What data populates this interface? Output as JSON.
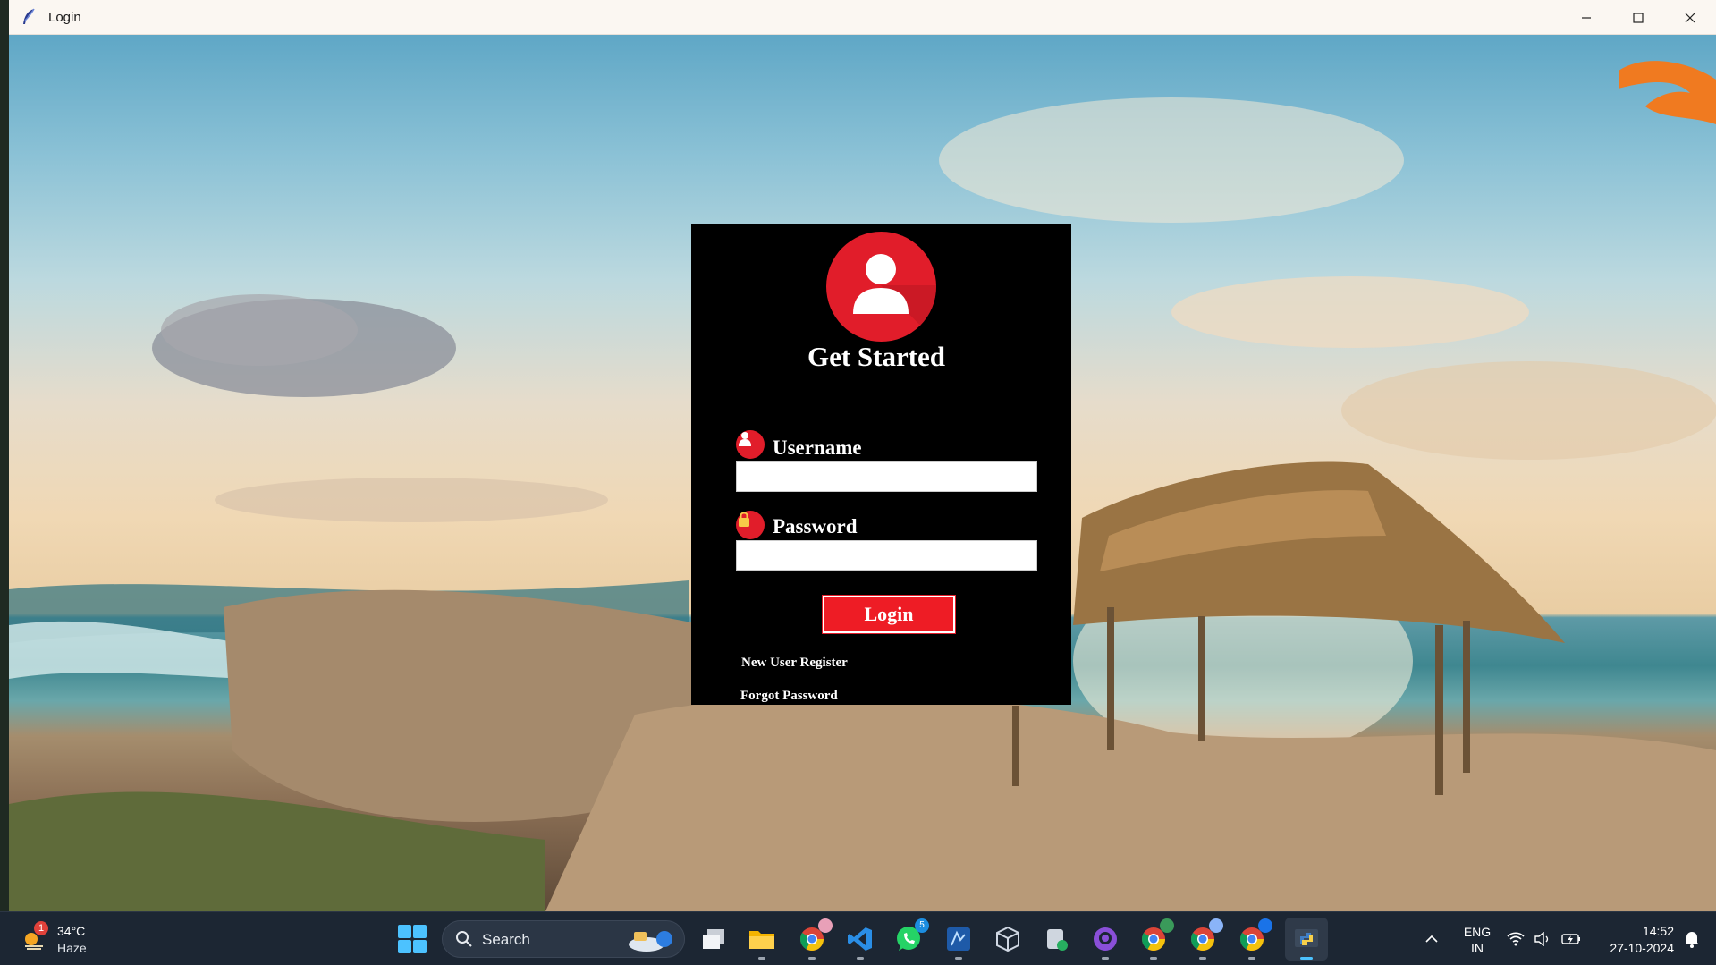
{
  "window": {
    "title": "Login"
  },
  "login": {
    "title": "Get Started",
    "username_label": "Username",
    "username_value": "",
    "password_label": "Password",
    "password_value": "",
    "login_button": "Login",
    "register_link": "New User Register",
    "forgot_link": "Forgot Password"
  },
  "taskbar": {
    "weather_temp": "34°C",
    "weather_desc": "Haze",
    "weather_badge": "1",
    "search_label": "Search",
    "whatsapp_badge": "5",
    "language_primary": "ENG",
    "language_secondary": "IN",
    "time": "14:52",
    "date": "27-10-2024"
  },
  "colors": {
    "card_bg": "#000000",
    "accent_red": "#e11d2a",
    "button_red": "#ee1c25",
    "taskbar_bg": "#1c2633"
  }
}
